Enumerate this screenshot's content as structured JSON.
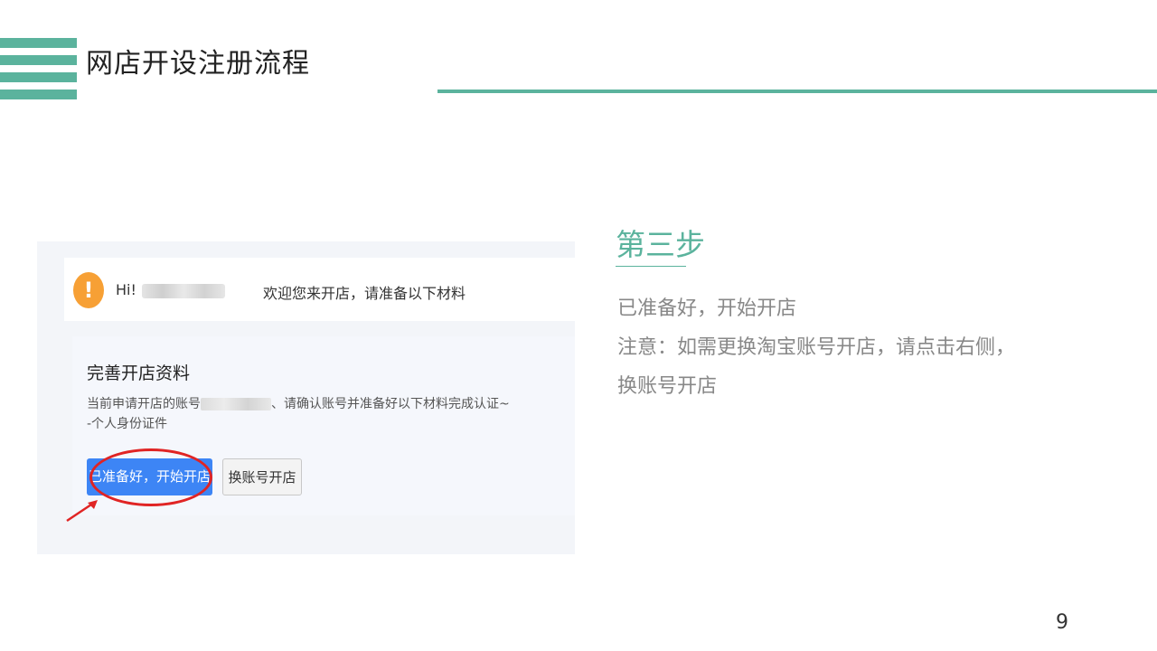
{
  "slide": {
    "title": "网店开设注册流程",
    "page_number": "9",
    "accent_color": "#5bb39d"
  },
  "screenshot": {
    "greeting": "Hi!",
    "welcome": "欢迎您来开店，请准备以下材料",
    "panel_title": "完善开店资料",
    "desc_prefix": "当前申请开店的账号",
    "desc_suffix": "、请确认账号并准备好以下材料完成认证~",
    "requirement": "-个人身份证件",
    "primary_button": "已准备好，开始开店",
    "secondary_button": "换账号开店",
    "warning_icon": "!",
    "button_color": "#3d85f5",
    "highlight_color": "#e02424"
  },
  "step": {
    "title": "第三步",
    "lines": [
      "已准备好，开始开店",
      "注意：如需更换淘宝账号开店，请点击右侧，",
      "换账号开店"
    ]
  }
}
